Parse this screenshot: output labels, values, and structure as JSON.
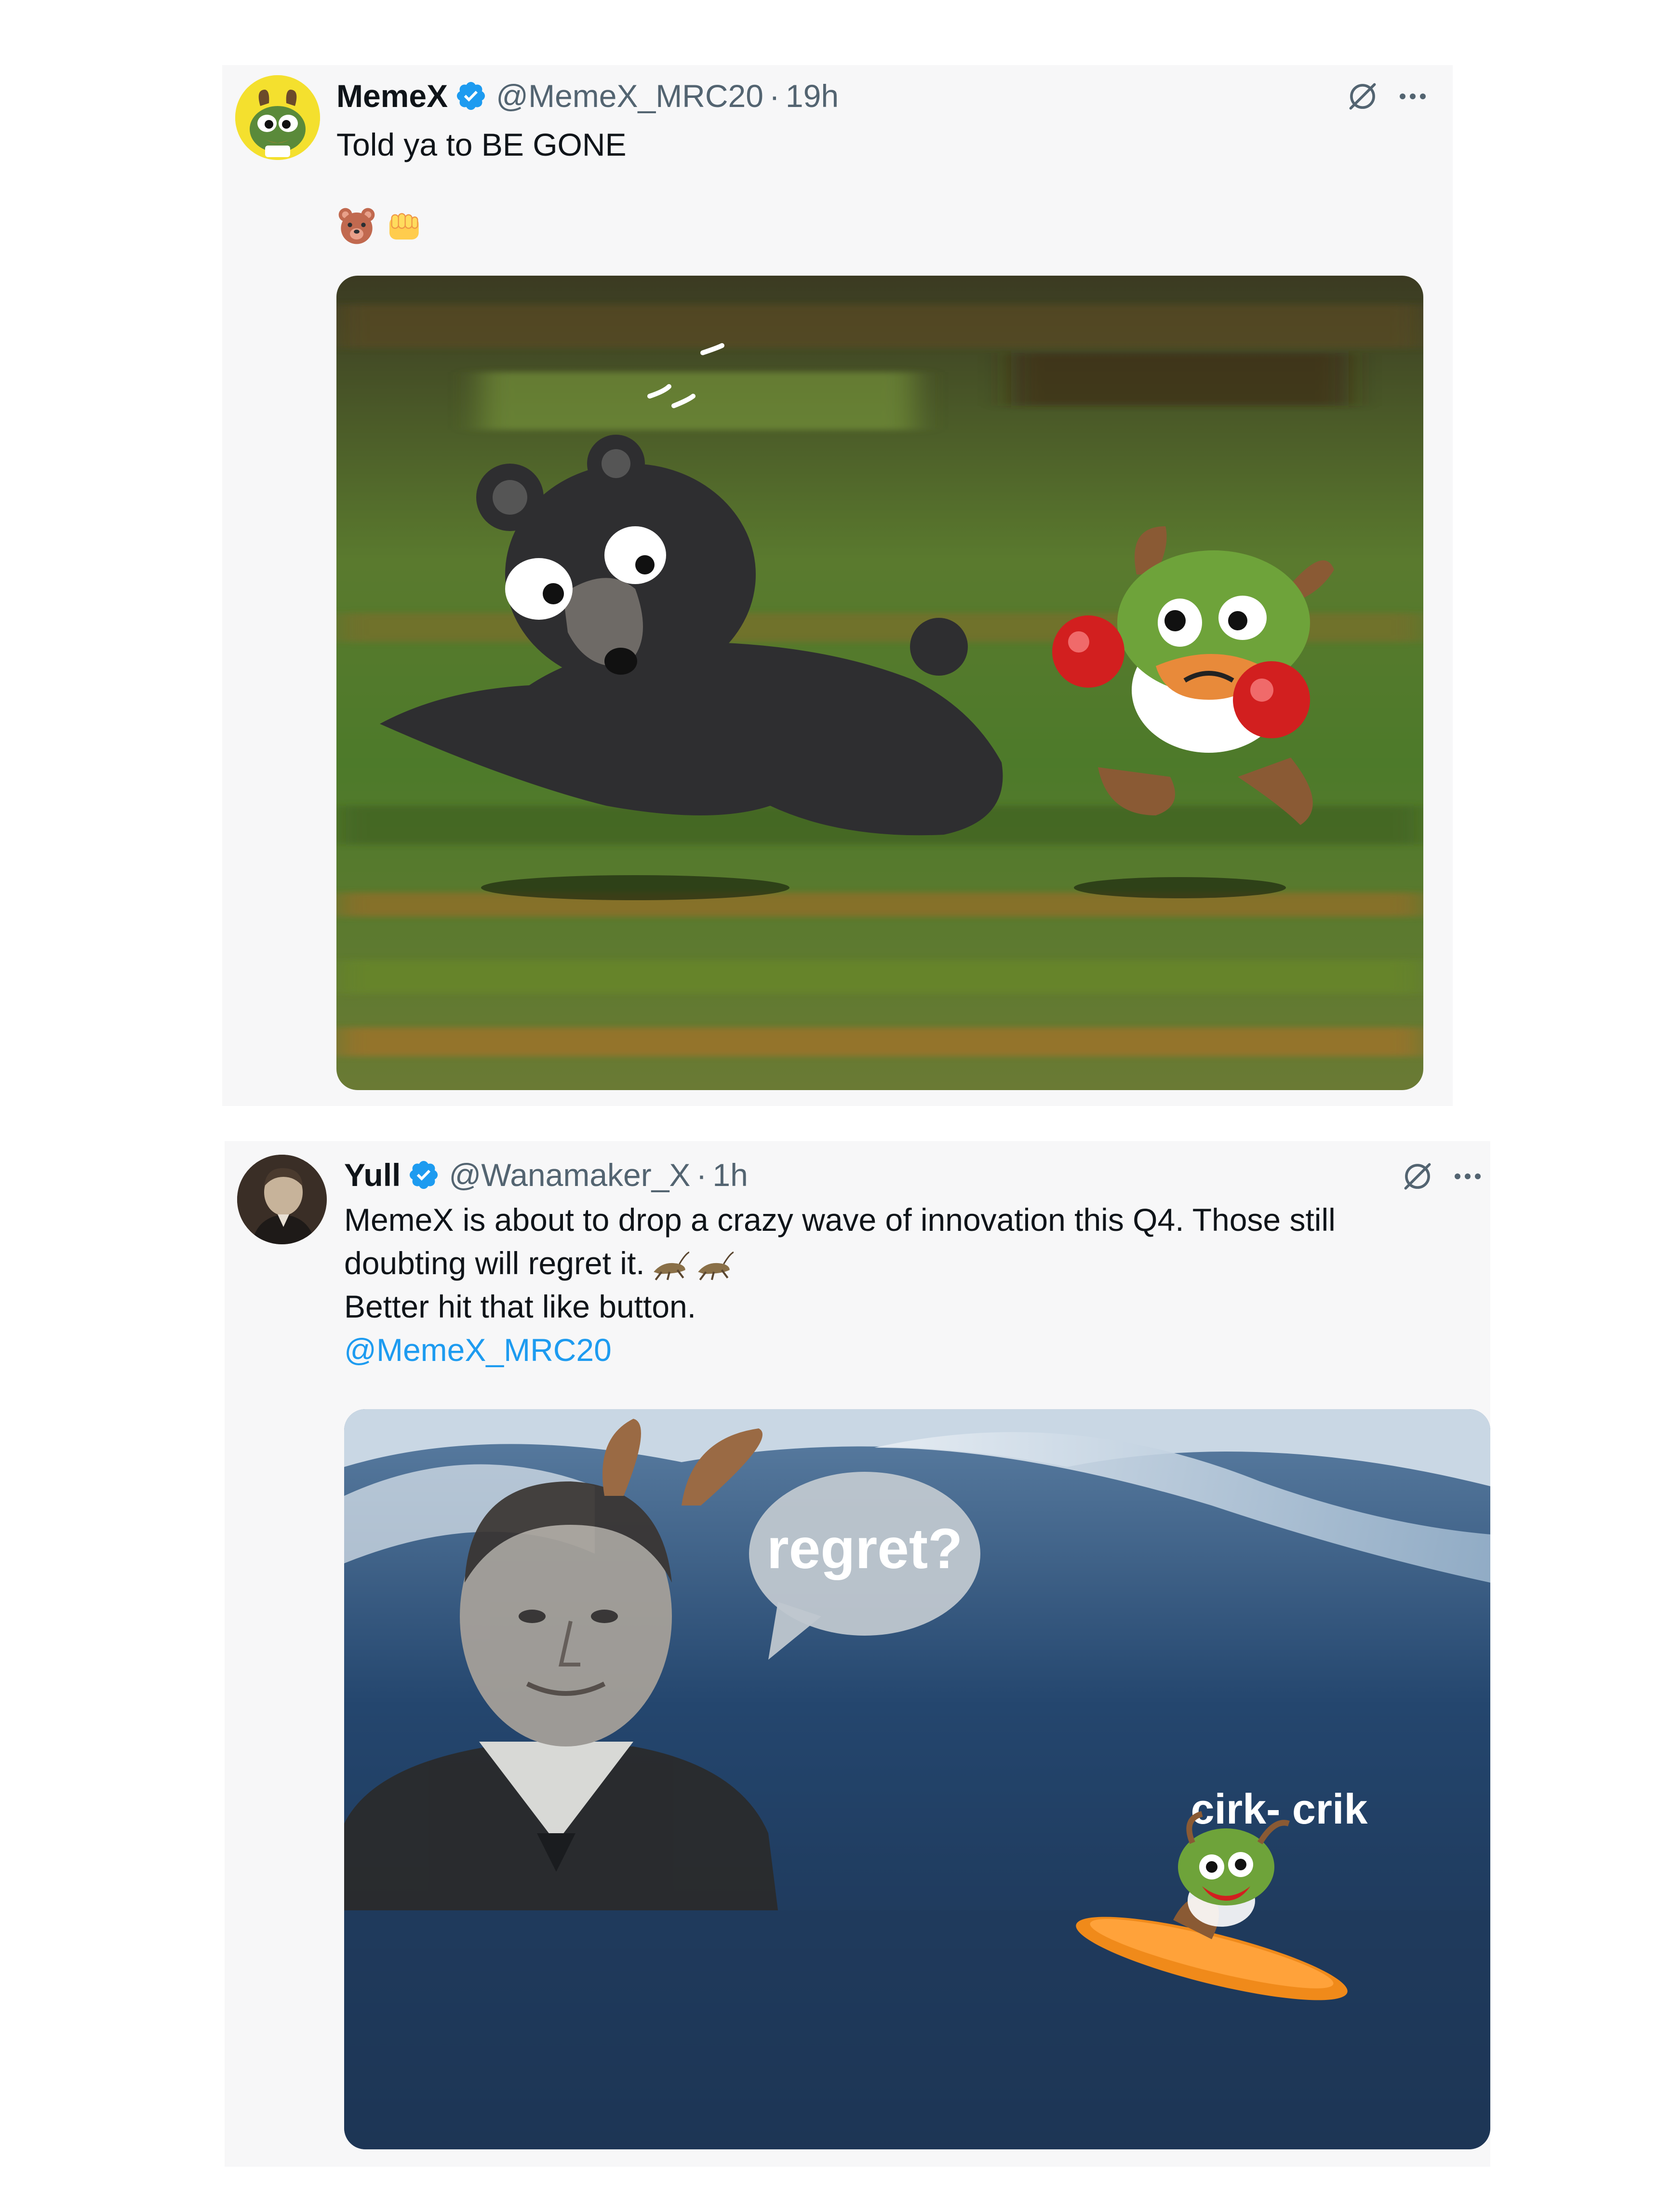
{
  "tweets": [
    {
      "display_name": "MemeX",
      "handle": "@MemeX_MRC20",
      "separator": "·",
      "time": "19h",
      "text_lines": [
        "Told ya to BE GONE"
      ],
      "emojis": [
        "bear-face-emoji",
        "oncoming-fist-emoji"
      ],
      "media_description_icon": "cartoon-bear-boxing-frog-image"
    },
    {
      "display_name": "Yull",
      "handle": "@Wanamaker_X",
      "separator": "·",
      "time": "1h",
      "text_lines": [
        "MemeX is about to drop a crazy wave of innovation this Q4. Those still",
        "doubting will regret it.",
        "Better hit that like button."
      ],
      "mention": "@MemeX_MRC20",
      "inline_emojis": [
        "cricket-emoji",
        "cricket-emoji"
      ],
      "media": {
        "bubble_text": "regret?",
        "caption_text": "cirk- crik"
      }
    }
  ],
  "colors": {
    "verified_blue": "#1d9bf0",
    "handle_gray": "#536471",
    "text_dark": "#0f1419",
    "card_bg": "#f7f7f8"
  }
}
